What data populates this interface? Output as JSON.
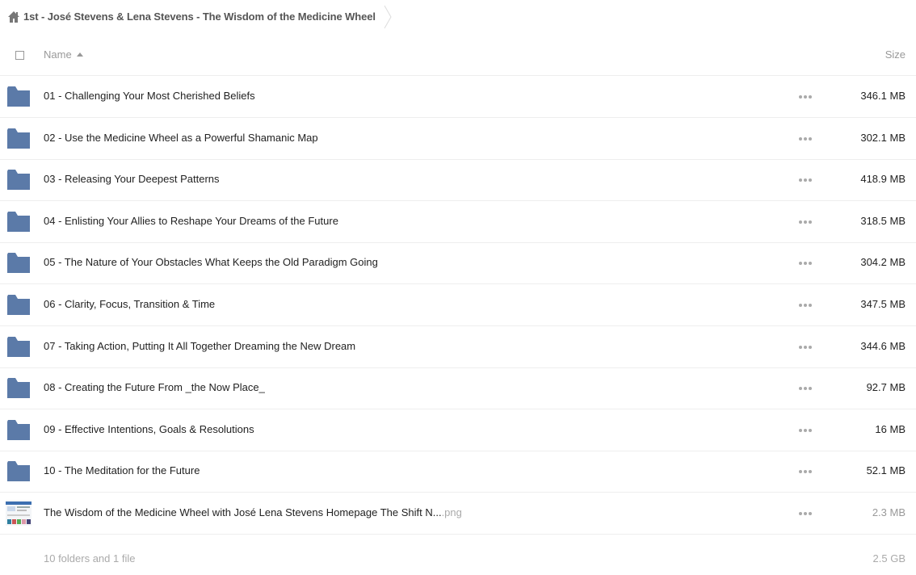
{
  "breadcrumb": {
    "home_icon": "home-icon",
    "current": "1st - José Stevens & Lena Stevens - The Wisdom of the Medicine Wheel"
  },
  "header": {
    "name_label": "Name",
    "size_label": "Size",
    "sort_icon": "sort-ascending-icon"
  },
  "colors": {
    "folder": "#5b7aa8",
    "separator": "#eeeeee",
    "muted_text": "#999999"
  },
  "files": [
    {
      "type": "folder",
      "name": "01 - Challenging Your Most Cherished Beliefs",
      "ext": "",
      "size": "346.1 MB"
    },
    {
      "type": "folder",
      "name": "02 - Use the Medicine Wheel as a Powerful Shamanic Map",
      "ext": "",
      "size": "302.1 MB"
    },
    {
      "type": "folder",
      "name": "03 - Releasing Your Deepest Patterns",
      "ext": "",
      "size": "418.9 MB"
    },
    {
      "type": "folder",
      "name": "04 - Enlisting Your Allies to Reshape Your Dreams of the Future",
      "ext": "",
      "size": "318.5 MB"
    },
    {
      "type": "folder",
      "name": "05 - The Nature of Your Obstacles What Keeps the Old Paradigm Going",
      "ext": "",
      "size": "304.2 MB"
    },
    {
      "type": "folder",
      "name": "06 - Clarity, Focus, Transition & Time",
      "ext": "",
      "size": "347.5 MB"
    },
    {
      "type": "folder",
      "name": "07 - Taking Action, Putting It All Together Dreaming the New Dream",
      "ext": "",
      "size": "344.6 MB"
    },
    {
      "type": "folder",
      "name": "08 - Creating the Future From _the Now Place_",
      "ext": "",
      "size": "92.7 MB"
    },
    {
      "type": "folder",
      "name": "09 - Effective Intentions, Goals & Resolutions",
      "ext": "",
      "size": "16 MB"
    },
    {
      "type": "folder",
      "name": "10 - The Meditation for the Future",
      "ext": "",
      "size": "52.1 MB"
    },
    {
      "type": "file",
      "name": "The Wisdom of the Medicine Wheel with José Lena Stevens Homepage The Shift N...",
      "ext": ".png",
      "size": "2.3 MB"
    }
  ],
  "summary": {
    "text": "10 folders and 1 file",
    "total_size": "2.5 GB"
  }
}
